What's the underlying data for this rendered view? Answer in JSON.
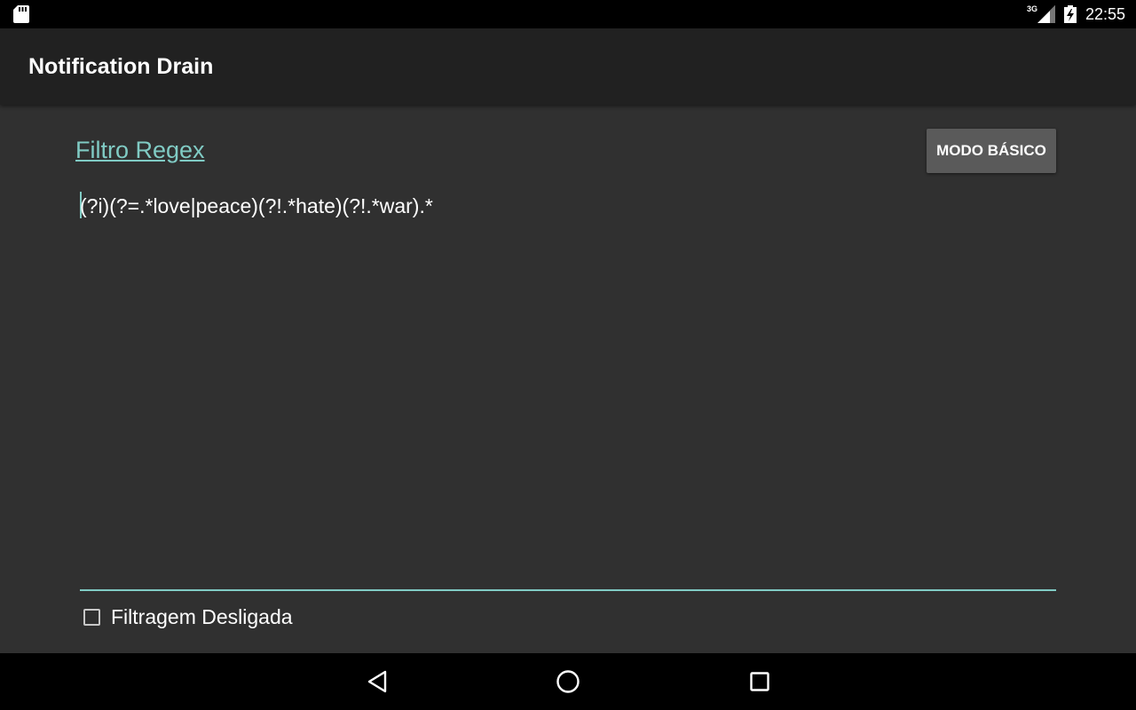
{
  "status_bar": {
    "network_type": "3G",
    "time": "22:55",
    "icons": [
      "sd-card-icon",
      "signal-icon",
      "battery-charging-icon"
    ]
  },
  "app_bar": {
    "title": "Notification Drain"
  },
  "main": {
    "filter_link_label": "Filtro Regex",
    "mode_button_label": "MODO BÁSICO",
    "regex_value": "(?i)(?=.*love|peace)(?!.*hate)(?!.*war).*",
    "filter_checkbox": {
      "label": "Filtragem Desligada",
      "checked": false
    }
  },
  "nav_bar": {
    "icons": [
      "back-icon",
      "home-icon",
      "recents-icon"
    ]
  },
  "colors": {
    "accent": "#80cbc4",
    "background": "#303030",
    "app_bar": "#212121",
    "button": "#5a5a5a"
  }
}
